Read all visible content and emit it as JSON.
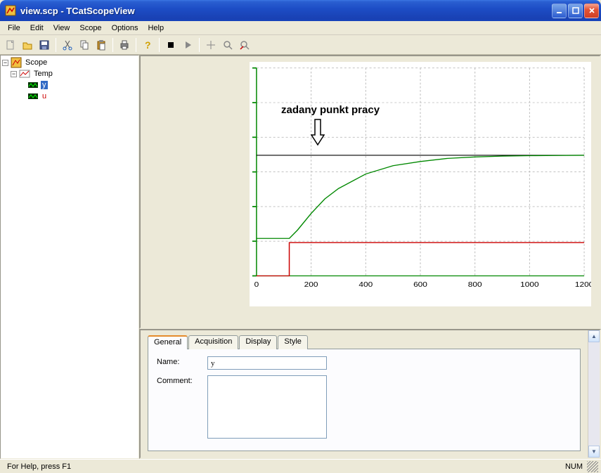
{
  "title": "view.scp - TCatScopeView",
  "menu": [
    "File",
    "Edit",
    "View",
    "Scope",
    "Options",
    "Help"
  ],
  "toolbar_icons": [
    "new",
    "open",
    "save",
    "cut",
    "copy",
    "paste",
    "print",
    "help",
    "stop",
    "play",
    "crosshair",
    "zoom",
    "zoom-reset"
  ],
  "tree": {
    "root": {
      "label": "Scope",
      "expanded": true
    },
    "child": {
      "label": "Temp",
      "expanded": true
    },
    "leaves": [
      {
        "label": "y",
        "color": "#008000",
        "selected": true
      },
      {
        "label": "u",
        "color": "#cc0000",
        "selected": false
      }
    ]
  },
  "annotation_text": "zadany punkt pracy",
  "tabs": [
    "General",
    "Acquisition",
    "Display",
    "Style"
  ],
  "active_tab": 0,
  "form": {
    "name_label": "Name:",
    "name_value": "y",
    "comment_label": "Comment:",
    "comment_value": ""
  },
  "status": {
    "help": "For Help, press F1",
    "num": "NUM"
  },
  "chart_data": {
    "type": "line",
    "xlabel": "",
    "ylabel": "",
    "xlim": [
      0,
      1200
    ],
    "x_ticks": [
      0,
      200,
      400,
      600,
      800,
      1000,
      1200
    ],
    "y_gridlines": 7,
    "annotation": "zadany punkt pracy",
    "setpoint_y_rel": 0.58,
    "series": [
      {
        "name": "y",
        "color": "#008800",
        "xy": [
          [
            0,
            0.18
          ],
          [
            120,
            0.18
          ],
          [
            150,
            0.22
          ],
          [
            200,
            0.3
          ],
          [
            250,
            0.37
          ],
          [
            300,
            0.42
          ],
          [
            400,
            0.49
          ],
          [
            500,
            0.53
          ],
          [
            600,
            0.55
          ],
          [
            700,
            0.565
          ],
          [
            800,
            0.572
          ],
          [
            900,
            0.576
          ],
          [
            1000,
            0.578
          ],
          [
            1100,
            0.579
          ],
          [
            1200,
            0.58
          ]
        ]
      },
      {
        "name": "u",
        "color": "#cc0000",
        "xy": [
          [
            0,
            0.0
          ],
          [
            120,
            0.0
          ],
          [
            120,
            0.16
          ],
          [
            1200,
            0.16
          ]
        ]
      }
    ]
  }
}
